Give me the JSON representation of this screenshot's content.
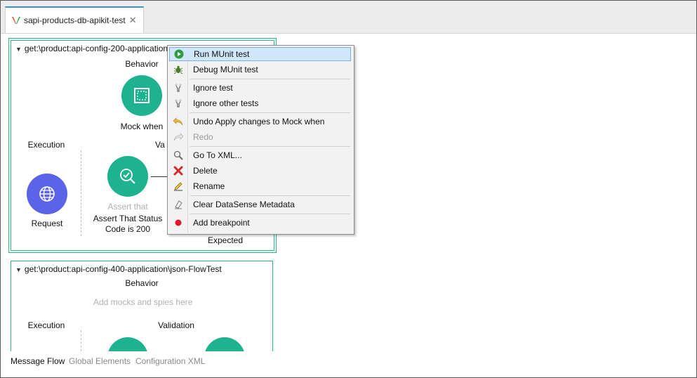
{
  "tab": {
    "title": "sapi-products-db-apikit-test",
    "close": "✕"
  },
  "test1": {
    "title": "get:\\product:api-config-200-application\\json-FlowTest",
    "behavior": "Behavior",
    "mock_label": "Mock when",
    "execution": "Execution",
    "validation_partial": "Va",
    "request_label": "Request",
    "assert_sub": "Assert that",
    "assert_label_line1": "Assert That Status",
    "assert_label_line2": "Code is 200",
    "expected_label": "Expected"
  },
  "test2": {
    "title": "get:\\product:api-config-400-application\\json-FlowTest",
    "behavior": "Behavior",
    "placeholder": "Add mocks and spies here",
    "execution": "Execution",
    "validation": "Validation"
  },
  "bottom_tabs": [
    "Message Flow",
    "Global Elements",
    "Configuration XML"
  ],
  "menu": {
    "items": [
      {
        "label": "Run MUnit test",
        "icon": "play-icon"
      },
      {
        "label": "Debug MUnit test",
        "icon": "bug-icon"
      },
      {
        "label": "Ignore test",
        "icon": "ignore-icon"
      },
      {
        "label": "Ignore other tests",
        "icon": "ignore-icon"
      },
      {
        "label": "Undo Apply changes to Mock when",
        "icon": "undo-icon"
      },
      {
        "label": "Redo",
        "icon": "redo-icon"
      },
      {
        "label": "Go To XML...",
        "icon": "magnifier-icon"
      },
      {
        "label": "Delete",
        "icon": "delete-icon"
      },
      {
        "label": "Rename",
        "icon": "rename-icon"
      },
      {
        "label": "Clear DataSense Metadata",
        "icon": "eraser-icon"
      },
      {
        "label": "Add breakpoint",
        "icon": "breakpoint-icon"
      }
    ]
  },
  "colors": {
    "accent": "#1fb291",
    "request": "#5b63e8",
    "selection_border": "#2fb57e",
    "highlight": "#cfe6fb"
  }
}
